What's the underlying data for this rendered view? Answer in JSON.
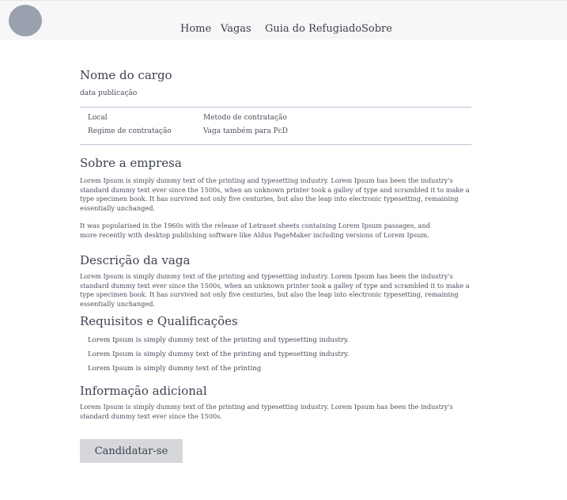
{
  "nav": {
    "items": [
      "Home",
      "Vagas",
      "Guia do Refugiado",
      "Sobre"
    ]
  },
  "job": {
    "title": "Nome do cargo",
    "date": "data publicação",
    "details": {
      "local": "Local",
      "metodo": "Metodo de contratação",
      "regime": "Regime de contratação",
      "pcd": "Vaga também para PcD"
    }
  },
  "sections": {
    "empresa": {
      "heading": "Sobre a empresa",
      "p1": "Lorem Ipsum is simply dummy text of the printing and typesetting industry. Lorem Ipsum has been the industry's standard dummy text ever since the 1500s, when an unknown printer took a galley of type and scrambled it to make a type specimen book. It has survived not only five centuries, but also the leap into electronic typesetting, remaining essentially unchanged.",
      "p2": "It was popularised in the 1960s with the release of Letraset sheets containing Lorem Ipsum passages, and more recently with desktop publishing software like Aldus PageMaker including versions of Lorem Ipsum."
    },
    "descricao": {
      "heading": "Descrição da vaga",
      "p1": "Lorem Ipsum is simply dummy text of the printing and typesetting industry. Lorem Ipsum has been the industry's standard dummy text ever since the 1500s, when an unknown printer took a galley of type and scrambled it to make a type specimen book. It has survived not only five centuries, but also the leap into electronic typesetting, remaining essentially unchanged."
    },
    "requisitos": {
      "heading": "Requisitos e Qualificações",
      "items": [
        "Lorem Ipsum is simply dummy text of the printing and typesetting industry.",
        "Lorem Ipsum is simply dummy text of the printing and typesetting industry.",
        "Lorem Ipsum is simply dummy text of the printing"
      ]
    },
    "adicional": {
      "heading": "Informação adicional",
      "p1": "Lorem Ipsum is simply dummy text of the printing and typesetting industry. Lorem Ipsum has been the industry's standard dummy text ever since the 1500s."
    }
  },
  "apply_label": "Candidatar-se",
  "colors": {
    "topbar": "#f7f7f8",
    "avatar": "#9aa0ad",
    "divider": "#bfc0d6",
    "button": "#d6d7db",
    "text": "#3d4250"
  }
}
